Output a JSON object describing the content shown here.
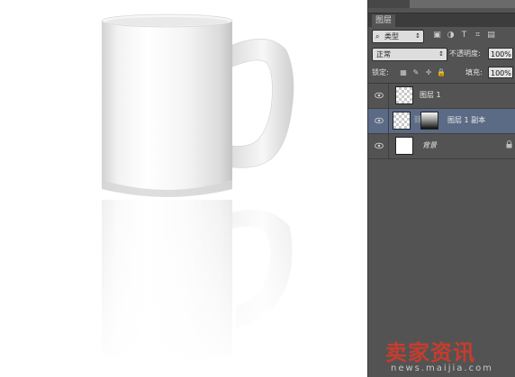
{
  "panel": {
    "tab_label": "图层",
    "filter": {
      "icon": "search-icon",
      "label": "类型"
    },
    "filter_icons": [
      "image-filter-icon",
      "adjustment-filter-icon",
      "type-filter-icon",
      "shape-filter-icon",
      "smart-object-filter-icon"
    ],
    "blend_mode": "正常",
    "opacity_label": "不透明度:",
    "opacity_value": "100%",
    "lock_label": "锁定:",
    "lock_icons": [
      "lock-transparent-icon",
      "lock-image-icon",
      "lock-position-icon",
      "lock-all-icon"
    ],
    "fill_label": "填充:",
    "fill_value": "100%",
    "layers": [
      {
        "name": "图层 1",
        "thumb": "transparent",
        "selected": false,
        "visible": true
      },
      {
        "name": "图层 1 副本",
        "thumb": "transparent-with-gradient-mask",
        "selected": true,
        "visible": true
      },
      {
        "name": "背景",
        "thumb": "white",
        "selected": false,
        "visible": true,
        "locked": true
      }
    ]
  },
  "watermark": {
    "text": "卖家资讯",
    "url": "news.maijia.com"
  },
  "colors": {
    "panel_bg": "#535353",
    "selected_layer": "#5b6b85",
    "watermark": "#d43a2a"
  }
}
